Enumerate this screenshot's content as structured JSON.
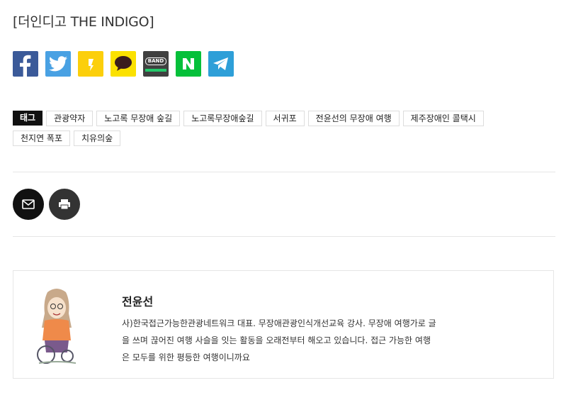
{
  "source": "[더인디고 THE INDIGO]",
  "share": {
    "items": [
      {
        "icon": "facebook-icon",
        "color": "#3b5a99"
      },
      {
        "icon": "twitter-icon",
        "color": "#49a1e3"
      },
      {
        "icon": "kakaostory-icon",
        "color": "#fccf0b"
      },
      {
        "icon": "kakaotalk-icon",
        "color": "#fbe100"
      },
      {
        "icon": "band-icon",
        "color": "#404040"
      },
      {
        "icon": "naver-icon",
        "color": "#05c03a"
      },
      {
        "icon": "telegram-icon",
        "color": "#2e9fd8"
      }
    ],
    "band_text": "BAND"
  },
  "tags": {
    "header": "태그",
    "items": [
      "관광약자",
      "노고록 무장애 숲길",
      "노고록무장애숲길",
      "서귀포",
      "전윤선의 무장애 여행",
      "제주장애인 콜택시",
      "천지연 폭포",
      "치유의숲"
    ]
  },
  "actions": {
    "email_icon": "envelope-icon",
    "print_icon": "printer-icon"
  },
  "author": {
    "name": "전윤선",
    "bio": "사)한국접근가능한관광네트워크 대표. 무장애관광인식개선교육 강사. 무장애 여행가로 글을 쓰며 끊어진 여행 사슬을 잇는 활동을 오래전부터 해오고 있습니다. 접근 가능한 여행은 모두를 위한 평등한 여행이니까요"
  }
}
